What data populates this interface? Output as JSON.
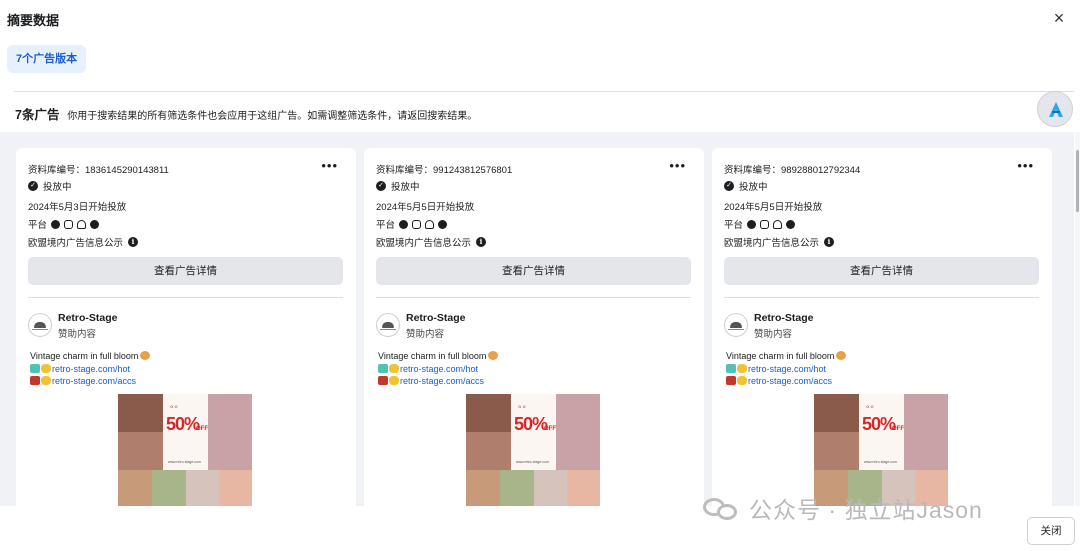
{
  "dialog": {
    "title": "摘要数据",
    "close_icon_glyph": "×",
    "close_button_label": "关闭"
  },
  "version_tab": {
    "label": "7个广告版本"
  },
  "summary": {
    "count": "7条广告",
    "note": "你用于搜索结果的所有筛选条件也会应用于这组广告。如需调整筛选条件，请返回搜索结果。"
  },
  "cards": [
    {
      "lib_id": "资料库编号：1836145290143811",
      "more": "•••",
      "status": "投放中",
      "start_date": "2024年5月3日开始投放",
      "platform_label": "平台",
      "eu_label": "欧盟境内广告信息公示",
      "details_button": "查看广告详情",
      "advertiser": "Retro-Stage",
      "sponsored": "赞助内容",
      "ad_line1": "Vintage charm in full bloom",
      "ad_link1": "retro-stage.com/hot",
      "ad_link2": "retro-stage.com/accs",
      "promo_sale": "50%",
      "promo_off": "OFF",
      "promo_url": "www.retro-stage.com"
    },
    {
      "lib_id": "资料库编号：991243812576801",
      "more": "•••",
      "status": "投放中",
      "start_date": "2024年5月5日开始投放",
      "platform_label": "平台",
      "eu_label": "欧盟境内广告信息公示",
      "details_button": "查看广告详情",
      "advertiser": "Retro-Stage",
      "sponsored": "赞助内容",
      "ad_line1": "Vintage charm in full bloom",
      "ad_link1": "retro-stage.com/hot",
      "ad_link2": "retro-stage.com/accs",
      "promo_sale": "50%",
      "promo_off": "OFF",
      "promo_url": "www.retro-stage.com"
    },
    {
      "lib_id": "资料库编号：989288012792344",
      "more": "•••",
      "status": "投放中",
      "start_date": "2024年5月5日开始投放",
      "platform_label": "平台",
      "eu_label": "欧盟境内广告信息公示",
      "details_button": "查看广告详情",
      "advertiser": "Retro-Stage",
      "sponsored": "赞助内容",
      "ad_line1": "Vintage charm in full bloom",
      "ad_link1": "retro-stage.com/hot",
      "ad_link2": "retro-stage.com/accs",
      "promo_sale": "50%",
      "promo_off": "OFF",
      "promo_url": "www.retro-stage.com"
    }
  ],
  "platform_icons": [
    "facebook-icon",
    "instagram-icon",
    "audience-network-icon",
    "messenger-icon"
  ],
  "watermark": {
    "text": "公众号 · 独立站Jason"
  },
  "colors": {
    "accent": "#1a5fd1",
    "tab_bg": "#e7f0fd",
    "panel_bg": "#f0f2f5",
    "button_bg": "#e4e6eb",
    "promo_red": "#d62828"
  }
}
